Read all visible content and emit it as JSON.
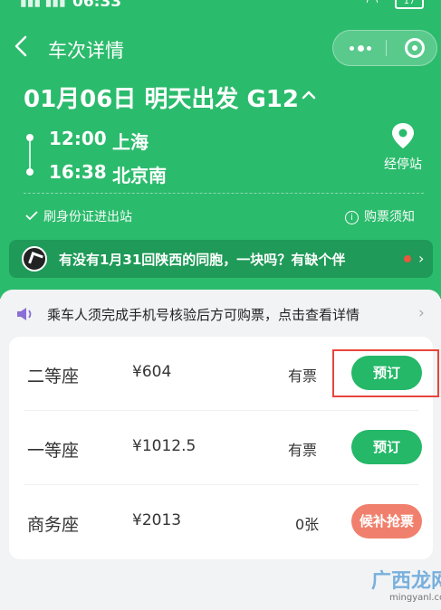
{
  "status_bar": {
    "time": "06:33",
    "battery": "17"
  },
  "header": {
    "title": "车次详情"
  },
  "trip": {
    "date_line": "01月06日  明天出发  G12",
    "depart_time": "12:00",
    "depart_station": "上海",
    "arrive_time": "16:38",
    "arrive_station": "北京南",
    "via_label": "经停站",
    "id_note": "刷身份证进出站",
    "ticket_notice": "购票须知"
  },
  "community": {
    "message": "有没有1月31回陕西的同胞，一块吗？有缺个伴"
  },
  "verify_banner": {
    "text": "乘车人须完成手机号核验后方可购票，点击查看详情"
  },
  "seats": [
    {
      "name": "二等座",
      "price": "¥604",
      "availability": "有票",
      "button": "预订",
      "button_color": "#24b868"
    },
    {
      "name": "一等座",
      "price": "¥1012.5",
      "availability": "有票",
      "button": "预订",
      "button_color": "#24b868"
    },
    {
      "name": "商务座",
      "price": "¥2013",
      "availability": "0张",
      "button": "候补抢票",
      "button_color": "#f0806d"
    }
  ],
  "watermark": {
    "title": "广西龙网",
    "url": "mingyanl.com"
  },
  "colors": {
    "primary_green": "#2bbb6c",
    "highlight_red": "#e8453c"
  }
}
